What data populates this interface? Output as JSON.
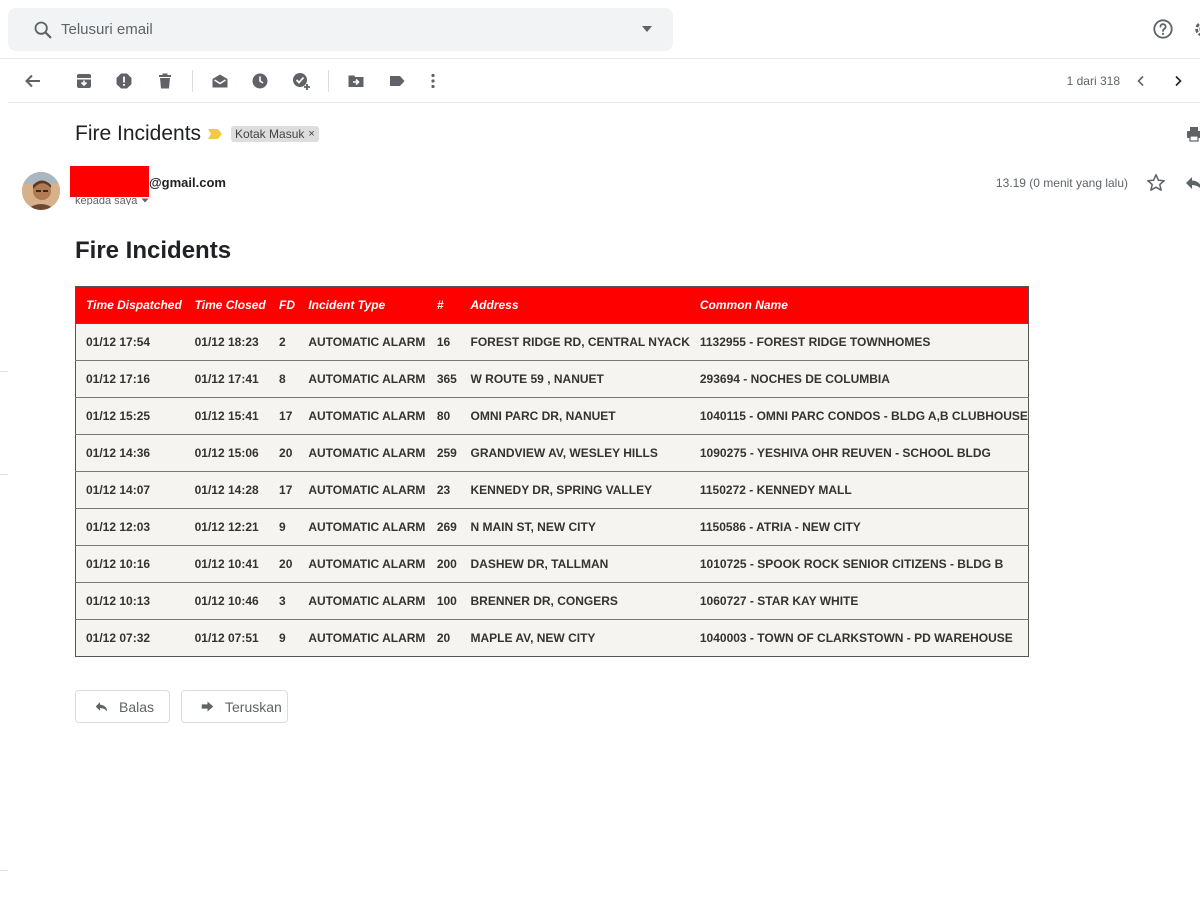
{
  "search": {
    "placeholder": "Telusuri email"
  },
  "icons": {
    "search": "search-icon",
    "dropdown": "arrow-drop-down-icon",
    "help": "help-icon",
    "settings": "gear-icon",
    "back": "arrow-back-icon",
    "archive": "archive-icon",
    "spam": "report-spam-icon",
    "delete": "trash-icon",
    "mark_unread": "mark-unread-icon",
    "snooze": "clock-icon",
    "add_task": "add-task-icon",
    "move": "move-to-icon",
    "label": "label-icon",
    "more": "more-vert-icon",
    "prev": "chevron-left-icon",
    "next": "chevron-right-icon",
    "print": "print-icon",
    "star": "star-icon",
    "reply": "reply-icon",
    "forward": "forward-icon"
  },
  "toolbar": {
    "pager": "1 dari 318"
  },
  "message": {
    "subject": "Fire Incidents",
    "label": "Kotak Masuk",
    "label_remove": "×",
    "sender_email": "@gmail.com",
    "recipient": "kepada saya",
    "timestamp": "13.19 (0 menit yang lalu)"
  },
  "body": {
    "title": "Fire Incidents",
    "table": {
      "headers": [
        "Time Dispatched",
        "Time Closed",
        "FD",
        "Incident Type",
        "#",
        "Address",
        "Common Name"
      ],
      "rows": [
        [
          "01/12 17:54",
          "01/12 18:23",
          "2",
          "AUTOMATIC ALARM",
          "16",
          "FOREST RIDGE RD, CENTRAL NYACK",
          "1132955 - FOREST RIDGE TOWNHOMES"
        ],
        [
          "01/12 17:16",
          "01/12 17:41",
          "8",
          "AUTOMATIC ALARM",
          "365",
          "W ROUTE 59 , NANUET",
          "293694 - NOCHES DE COLUMBIA"
        ],
        [
          "01/12 15:25",
          "01/12 15:41",
          "17",
          "AUTOMATIC ALARM",
          "80",
          "OMNI PARC DR, NANUET",
          "1040115 - OMNI PARC CONDOS - BLDG A,B CLUBHOUSE"
        ],
        [
          "01/12 14:36",
          "01/12 15:06",
          "20",
          "AUTOMATIC ALARM",
          "259",
          "GRANDVIEW AV, WESLEY HILLS",
          "1090275 - YESHIVA OHR REUVEN - SCHOOL BLDG"
        ],
        [
          "01/12 14:07",
          "01/12 14:28",
          "17",
          "AUTOMATIC ALARM",
          "23",
          "KENNEDY DR, SPRING VALLEY",
          "1150272 - KENNEDY MALL"
        ],
        [
          "01/12 12:03",
          "01/12 12:21",
          "9",
          "AUTOMATIC ALARM",
          "269",
          "N MAIN ST, NEW CITY",
          "1150586 - ATRIA - NEW CITY"
        ],
        [
          "01/12 10:16",
          "01/12 10:41",
          "20",
          "AUTOMATIC ALARM",
          "200",
          "DASHEW DR, TALLMAN",
          "1010725 - SPOOK ROCK SENIOR CITIZENS - BLDG B"
        ],
        [
          "01/12 10:13",
          "01/12 10:46",
          "3",
          "AUTOMATIC ALARM",
          "100",
          "BRENNER DR, CONGERS",
          "1060727 - STAR KAY WHITE"
        ],
        [
          "01/12 07:32",
          "01/12 07:51",
          "9",
          "AUTOMATIC ALARM",
          "20",
          "MAPLE AV, NEW CITY",
          "1040003 - TOWN OF CLARKSTOWN - PD WAREHOUSE"
        ]
      ]
    }
  },
  "actions": {
    "reply": "Balas",
    "forward": "Teruskan"
  },
  "colors": {
    "table_header": "#ff0000",
    "row_bg": "#f6f4f0",
    "search_bg": "#f1f3f4",
    "icon": "#5f6368"
  }
}
